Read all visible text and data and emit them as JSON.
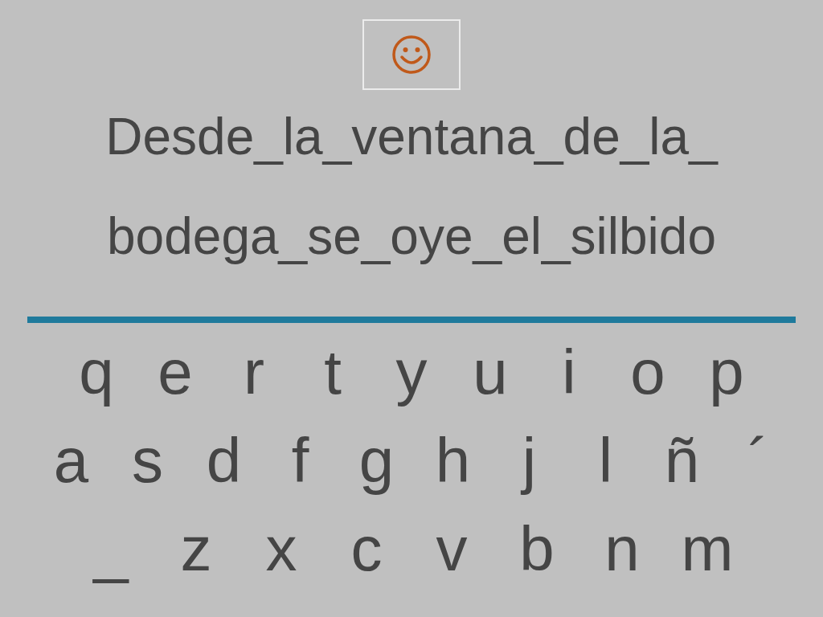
{
  "sentence": {
    "lines": [
      "Desde_la_ventana_de_la_",
      "bodega_se_oye_el_silbido"
    ]
  },
  "keyboard": {
    "rows": [
      {
        "keys": [
          "q",
          "e",
          "r",
          "t",
          "y",
          "u",
          "i",
          "o",
          "p"
        ]
      },
      {
        "keys": [
          "a",
          "s",
          "d",
          "f",
          "g",
          "h",
          "j",
          "l",
          "ñ",
          "´"
        ]
      },
      {
        "keys": [
          "_",
          "z",
          "x",
          "c",
          "v",
          "b",
          "n",
          "m"
        ]
      }
    ]
  }
}
